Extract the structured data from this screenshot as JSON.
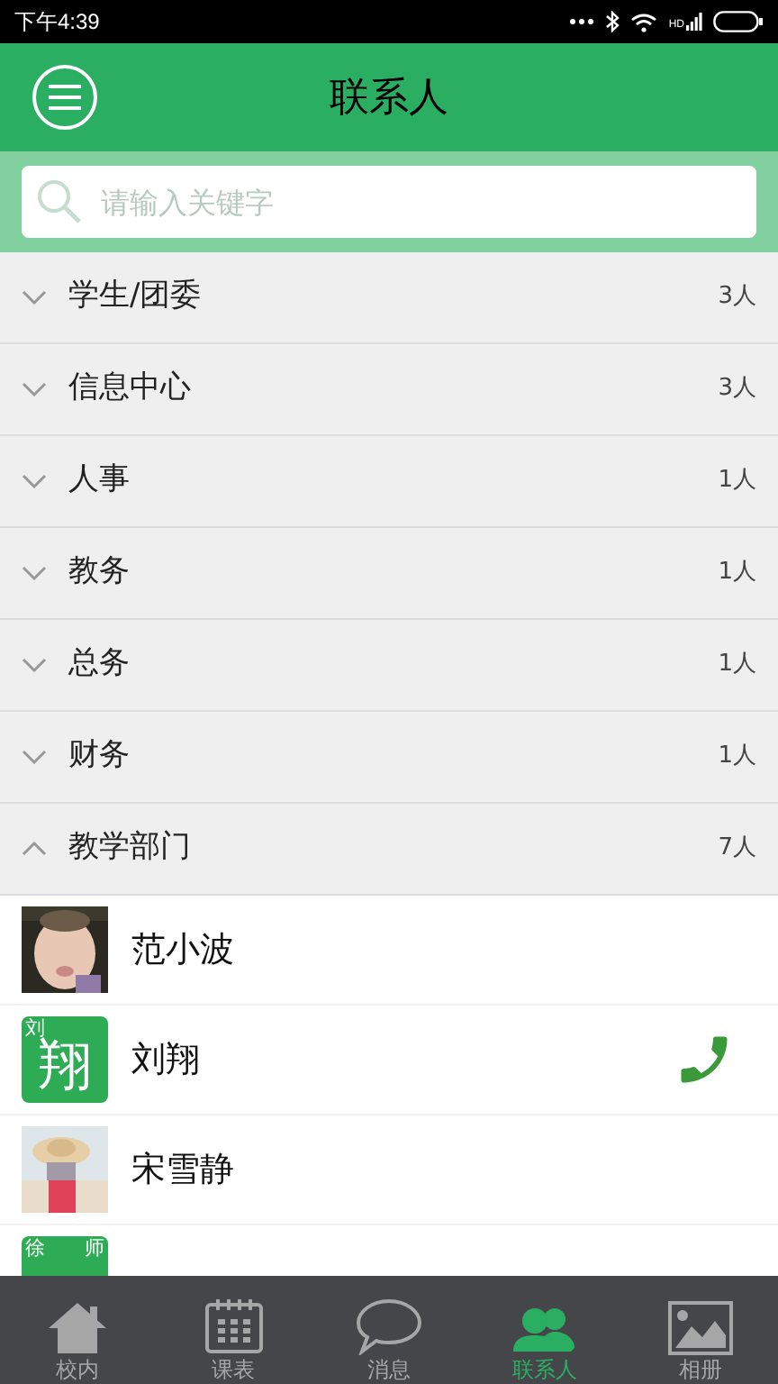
{
  "status_bar": {
    "time": "下午4:39",
    "network": "HD"
  },
  "header": {
    "title": "联系人"
  },
  "search": {
    "placeholder": "请输入关键字"
  },
  "groups": [
    {
      "name": "学生/团委",
      "count": "3人",
      "expanded": false
    },
    {
      "name": "信息中心",
      "count": "3人",
      "expanded": false
    },
    {
      "name": "人事",
      "count": "1人",
      "expanded": false
    },
    {
      "name": "教务",
      "count": "1人",
      "expanded": false
    },
    {
      "name": "总务",
      "count": "1人",
      "expanded": false
    },
    {
      "name": "财务",
      "count": "1人",
      "expanded": false
    },
    {
      "name": "教学部门",
      "count": "7人",
      "expanded": true
    }
  ],
  "contacts": [
    {
      "name": "范小波",
      "call": false
    },
    {
      "name": "刘翔",
      "avatar": {
        "kind": "text",
        "corner": "刘",
        "main": "翔"
      },
      "call": true
    },
    {
      "name": "宋雪静",
      "call": false
    },
    {
      "avatar": {
        "kind": "text",
        "corner": "徐",
        "corner_right": "师"
      },
      "call": false
    }
  ],
  "tabs": [
    {
      "label": "校内",
      "selected": false
    },
    {
      "label": "课表",
      "selected": false
    },
    {
      "label": "消息",
      "selected": false
    },
    {
      "label": "联系人",
      "selected": true
    },
    {
      "label": "相册",
      "selected": false
    }
  ]
}
